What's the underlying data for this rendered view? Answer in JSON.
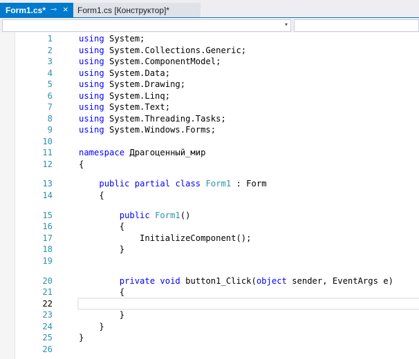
{
  "tabs": [
    {
      "label": "Form1.cs*",
      "pin": "⊸",
      "close": "×",
      "active": true
    },
    {
      "label": "Form1.cs [Конструктор]*",
      "active": false
    }
  ],
  "navbar": {
    "left_arrow": "▾"
  },
  "editor": {
    "current_line": 22,
    "lines": [
      {
        "num": "1",
        "tokens": [
          {
            "t": "using",
            "c": "kw"
          },
          {
            "t": " System;",
            "c": "txt"
          }
        ]
      },
      {
        "num": "2",
        "tokens": [
          {
            "t": "using",
            "c": "kw"
          },
          {
            "t": " System.Collections.Generic;",
            "c": "txt"
          }
        ]
      },
      {
        "num": "3",
        "tokens": [
          {
            "t": "using",
            "c": "kw"
          },
          {
            "t": " System.ComponentModel;",
            "c": "txt"
          }
        ]
      },
      {
        "num": "4",
        "tokens": [
          {
            "t": "using",
            "c": "kw"
          },
          {
            "t": " System.Data;",
            "c": "txt"
          }
        ]
      },
      {
        "num": "5",
        "tokens": [
          {
            "t": "using",
            "c": "kw"
          },
          {
            "t": " System.Drawing;",
            "c": "txt"
          }
        ]
      },
      {
        "num": "6",
        "tokens": [
          {
            "t": "using",
            "c": "kw"
          },
          {
            "t": " System.Linq;",
            "c": "txt"
          }
        ]
      },
      {
        "num": "7",
        "tokens": [
          {
            "t": "using",
            "c": "kw"
          },
          {
            "t": " System.Text;",
            "c": "txt"
          }
        ]
      },
      {
        "num": "8",
        "tokens": [
          {
            "t": "using",
            "c": "kw"
          },
          {
            "t": " System.Threading.Tasks;",
            "c": "txt"
          }
        ]
      },
      {
        "num": "9",
        "tokens": [
          {
            "t": "using",
            "c": "kw"
          },
          {
            "t": " System.Windows.Forms;",
            "c": "txt"
          }
        ]
      },
      {
        "num": "10",
        "tokens": []
      },
      {
        "num": "11",
        "tokens": [
          {
            "t": "namespace",
            "c": "kw"
          },
          {
            "t": " Драгоценный_мир",
            "c": "txt"
          }
        ]
      },
      {
        "num": "12",
        "tokens": [
          {
            "t": "{",
            "c": "txt"
          }
        ]
      },
      {
        "num": "13",
        "tokens": [
          {
            "t": "    ",
            "c": "txt"
          },
          {
            "t": "public",
            "c": "kw"
          },
          {
            "t": " ",
            "c": "txt"
          },
          {
            "t": "partial",
            "c": "kw"
          },
          {
            "t": " ",
            "c": "txt"
          },
          {
            "t": "class",
            "c": "kw"
          },
          {
            "t": " ",
            "c": "txt"
          },
          {
            "t": "Form1",
            "c": "ty"
          },
          {
            "t": " : Form",
            "c": "txt"
          }
        ]
      },
      {
        "num": "14",
        "tokens": [
          {
            "t": "    {",
            "c": "txt"
          }
        ]
      },
      {
        "num": "15",
        "tokens": [
          {
            "t": "        ",
            "c": "txt"
          },
          {
            "t": "public",
            "c": "kw"
          },
          {
            "t": " ",
            "c": "txt"
          },
          {
            "t": "Form1",
            "c": "ty"
          },
          {
            "t": "()",
            "c": "txt"
          }
        ]
      },
      {
        "num": "16",
        "tokens": [
          {
            "t": "        {",
            "c": "txt"
          }
        ]
      },
      {
        "num": "17",
        "tokens": [
          {
            "t": "            InitializeComponent();",
            "c": "txt"
          }
        ]
      },
      {
        "num": "18",
        "tokens": [
          {
            "t": "        }",
            "c": "txt"
          }
        ]
      },
      {
        "num": "19",
        "tokens": []
      },
      {
        "num": "20",
        "tokens": [
          {
            "t": "        ",
            "c": "txt"
          },
          {
            "t": "private",
            "c": "kw"
          },
          {
            "t": " ",
            "c": "txt"
          },
          {
            "t": "void",
            "c": "kw"
          },
          {
            "t": " button1_Click(",
            "c": "txt"
          },
          {
            "t": "object",
            "c": "kw"
          },
          {
            "t": " sender, EventArgs e)",
            "c": "txt"
          }
        ]
      },
      {
        "num": "21",
        "tokens": [
          {
            "t": "        {",
            "c": "txt"
          }
        ]
      },
      {
        "num": "22",
        "tokens": []
      },
      {
        "num": "23",
        "tokens": [
          {
            "t": "        }",
            "c": "txt"
          }
        ]
      },
      {
        "num": "24",
        "tokens": [
          {
            "t": "    }",
            "c": "txt"
          }
        ]
      },
      {
        "num": "25",
        "tokens": [
          {
            "t": "}",
            "c": "txt"
          }
        ]
      },
      {
        "num": "26",
        "tokens": []
      }
    ]
  },
  "colors": {
    "keyword": "#0000ff",
    "type": "#2b91af",
    "line_number": "#2b91af",
    "active_tab": "#007acc"
  }
}
